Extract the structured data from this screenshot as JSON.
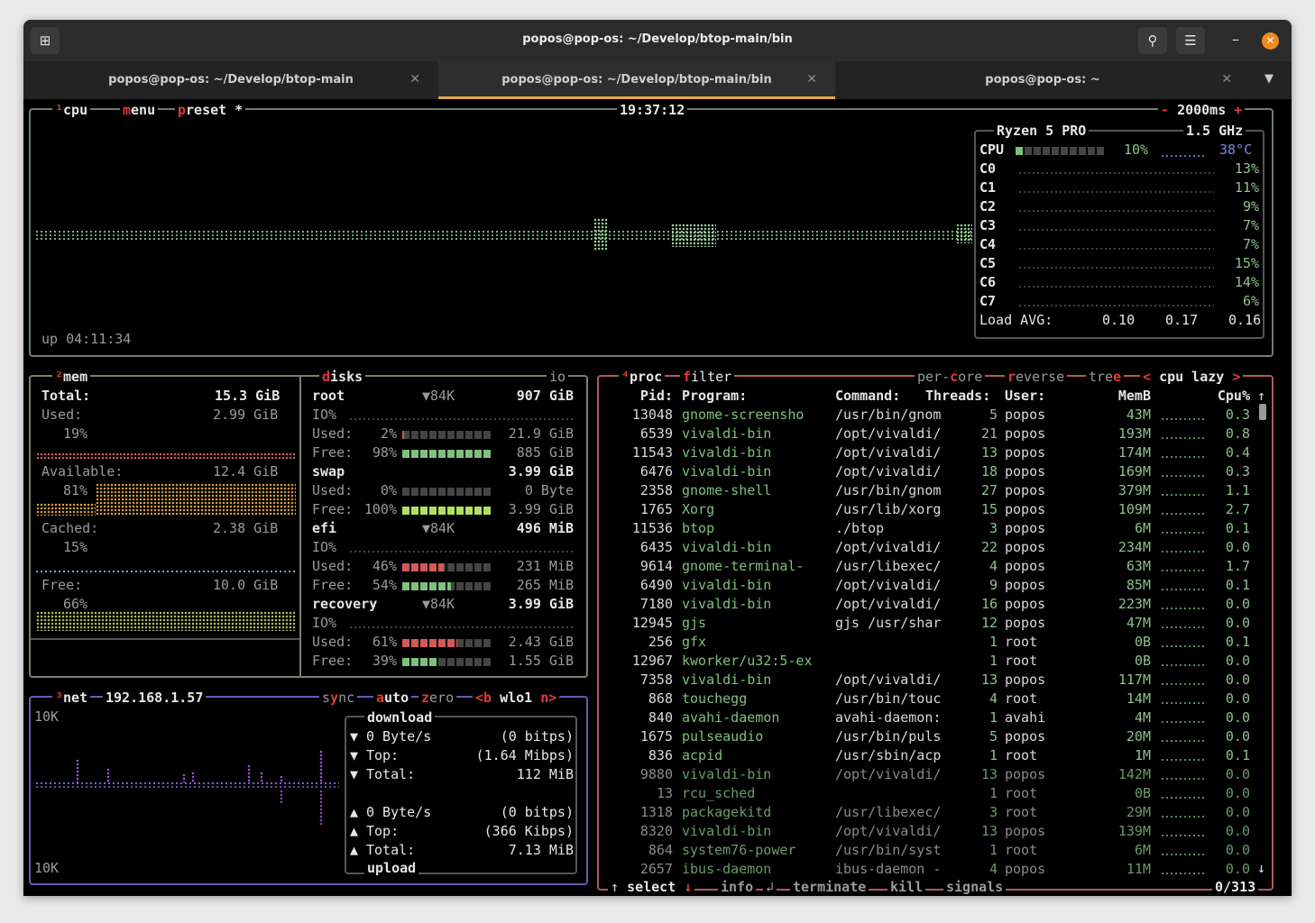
{
  "window": {
    "title": "popos@pop-os: ~/Develop/btop-main/bin"
  },
  "tabs": [
    {
      "label": "popos@pop-os: ~/Develop/btop-main"
    },
    {
      "label": "popos@pop-os: ~/Develop/btop-main/bin"
    },
    {
      "label": "popos@pop-os: ~"
    }
  ],
  "colors": {
    "cpu_border": "#7a8a7a",
    "mem_border": "#8a8a7a",
    "net_border": "#7a6ab0",
    "proc_border": "#b86a6a",
    "accent": "#e03b3b"
  },
  "cpu": {
    "num": "¹",
    "label": "cpu",
    "menu": "menu",
    "preset": "preset *",
    "clock": "19:37:12",
    "interval": "2000ms",
    "minus": "-",
    "plus": "+",
    "uptime": "up 04:11:34",
    "model": "Ryzen 5 PRO",
    "freq": "1.5 GHz",
    "total_label": "CPU",
    "total_pct": "10%",
    "total_fill": 0.1,
    "temp": "38°C",
    "cores": [
      {
        "name": "C0",
        "pct": "13%"
      },
      {
        "name": "C1",
        "pct": "11%"
      },
      {
        "name": "C2",
        "pct": "9%"
      },
      {
        "name": "C3",
        "pct": "7%"
      },
      {
        "name": "C4",
        "pct": "7%"
      },
      {
        "name": "C5",
        "pct": "15%"
      },
      {
        "name": "C6",
        "pct": "14%"
      },
      {
        "name": "C7",
        "pct": "6%"
      }
    ],
    "load_label": "Load AVG:",
    "load": [
      "0.10",
      "0.17",
      "0.16"
    ]
  },
  "mem": {
    "num": "²",
    "label": "mem",
    "total_label": "Total:",
    "total": "15.3 GiB",
    "used_label": "Used:",
    "used": "2.99 GiB",
    "used_pct": "19%",
    "avail_label": "Available:",
    "avail": "12.4 GiB",
    "avail_pct": "81%",
    "cached_label": "Cached:",
    "cached": "2.38 GiB",
    "cached_pct": "15%",
    "free_label": "Free:",
    "free": "10.0 GiB",
    "free_pct": "66%"
  },
  "disks": {
    "label": "disks",
    "io": "io",
    "items": [
      {
        "name": "root",
        "io_speed": "▼84K",
        "size": "907 GiB",
        "io": "IO%",
        "used_label": "Used:",
        "used_pct": "2%",
        "used": "21.9 GiB",
        "used_fill": 0.02,
        "free_label": "Free:",
        "free_pct": "98%",
        "free": "885 GiB",
        "free_fill": 0.98
      },
      {
        "name": "swap",
        "io_speed": "",
        "size": "3.99 GiB",
        "io": "",
        "used_label": "Used:",
        "used_pct": "0%",
        "used": "0 Byte",
        "used_fill": 0,
        "free_label": "Free:",
        "free_pct": "100%",
        "free": "3.99 GiB",
        "free_fill": 1.0
      },
      {
        "name": "efi",
        "io_speed": "▼84K",
        "size": "496 MiB",
        "io": "IO%",
        "used_label": "Used:",
        "used_pct": "46%",
        "used": "231 MiB",
        "used_fill": 0.46,
        "free_label": "Free:",
        "free_pct": "54%",
        "free": "265 MiB",
        "free_fill": 0.54
      },
      {
        "name": "recovery",
        "io_speed": "▼84K",
        "size": "3.99 GiB",
        "io": "IO%",
        "used_label": "Used:",
        "used_pct": "61%",
        "used": "2.43 GiB",
        "used_fill": 0.61,
        "free_label": "Free:",
        "free_pct": "39%",
        "free": "1.55 GiB",
        "free_fill": 0.39
      }
    ]
  },
  "net": {
    "num": "³",
    "label": "net",
    "ip": "192.168.1.57",
    "sync": "sync",
    "auto": "auto",
    "zero": "zero",
    "b": "<b",
    "iface": "wlo1",
    "n": "n>",
    "scale_top": "10K",
    "scale_bottom": "10K",
    "download_label": "download",
    "upload_label": "upload",
    "down": [
      {
        "sym": "▼",
        "label": "0 Byte/s",
        "value": "(0 bitps)"
      },
      {
        "sym": "▼",
        "label": "Top:",
        "value": "(1.64 Mibps)"
      },
      {
        "sym": "▼",
        "label": "Total:",
        "value": "112 MiB"
      }
    ],
    "up": [
      {
        "sym": "▲",
        "label": "0 Byte/s",
        "value": "(0 bitps)"
      },
      {
        "sym": "▲",
        "label": "Top:",
        "value": "(366 Kibps)"
      },
      {
        "sym": "▲",
        "label": "Total:",
        "value": "7.13 MiB"
      }
    ]
  },
  "proc": {
    "num": "⁴",
    "label": "proc",
    "filter": "filter",
    "percore": "per-core",
    "reverse": "reverse",
    "tree": "tree",
    "sort_left": "<",
    "sort": "cpu lazy",
    "sort_right": ">",
    "headers": {
      "pid": "Pid:",
      "program": "Program:",
      "command": "Command:",
      "threads": "Threads:",
      "user": "User:",
      "mem": "MemB",
      "cpu": "Cpu%"
    },
    "rows": [
      {
        "pid": "13048",
        "program": "gnome-screensho",
        "command": "/usr/bin/gnom",
        "threads": "5",
        "user": "popos",
        "mem": "43M",
        "cpu": "0.3"
      },
      {
        "pid": "6539",
        "program": "vivaldi-bin",
        "command": "/opt/vivaldi/",
        "threads": "21",
        "user": "popos",
        "mem": "193M",
        "cpu": "0.8"
      },
      {
        "pid": "11543",
        "program": "vivaldi-bin",
        "command": "/opt/vivaldi/",
        "threads": "13",
        "user": "popos",
        "mem": "174M",
        "cpu": "0.4"
      },
      {
        "pid": "6476",
        "program": "vivaldi-bin",
        "command": "/opt/vivaldi/",
        "threads": "18",
        "user": "popos",
        "mem": "169M",
        "cpu": "0.3"
      },
      {
        "pid": "2358",
        "program": "gnome-shell",
        "command": "/usr/bin/gnom",
        "threads": "27",
        "user": "popos",
        "mem": "379M",
        "cpu": "1.1"
      },
      {
        "pid": "1765",
        "program": "Xorg",
        "command": "/usr/lib/xorg",
        "threads": "15",
        "user": "popos",
        "mem": "109M",
        "cpu": "2.7"
      },
      {
        "pid": "11536",
        "program": "btop",
        "command": "./btop",
        "threads": "3",
        "user": "popos",
        "mem": "6M",
        "cpu": "0.1"
      },
      {
        "pid": "6435",
        "program": "vivaldi-bin",
        "command": "/opt/vivaldi/",
        "threads": "22",
        "user": "popos",
        "mem": "234M",
        "cpu": "0.0"
      },
      {
        "pid": "9614",
        "program": "gnome-terminal-",
        "command": "/usr/libexec/",
        "threads": "4",
        "user": "popos",
        "mem": "63M",
        "cpu": "1.7"
      },
      {
        "pid": "6490",
        "program": "vivaldi-bin",
        "command": "/opt/vivaldi/",
        "threads": "9",
        "user": "popos",
        "mem": "85M",
        "cpu": "0.1"
      },
      {
        "pid": "7180",
        "program": "vivaldi-bin",
        "command": "/opt/vivaldi/",
        "threads": "16",
        "user": "popos",
        "mem": "223M",
        "cpu": "0.0"
      },
      {
        "pid": "12945",
        "program": "gjs",
        "command": "gjs /usr/shar",
        "threads": "12",
        "user": "popos",
        "mem": "47M",
        "cpu": "0.0"
      },
      {
        "pid": "256",
        "program": "gfx",
        "command": "",
        "threads": "1",
        "user": "root",
        "mem": "0B",
        "cpu": "0.1"
      },
      {
        "pid": "12967",
        "program": "kworker/u32:5-ex",
        "command": "",
        "threads": "1",
        "user": "root",
        "mem": "0B",
        "cpu": "0.0"
      },
      {
        "pid": "7358",
        "program": "vivaldi-bin",
        "command": "/opt/vivaldi/",
        "threads": "13",
        "user": "popos",
        "mem": "117M",
        "cpu": "0.0"
      },
      {
        "pid": "868",
        "program": "touchegg",
        "command": "/usr/bin/touc",
        "threads": "4",
        "user": "root",
        "mem": "14M",
        "cpu": "0.0"
      },
      {
        "pid": "840",
        "program": "avahi-daemon",
        "command": "avahi-daemon:",
        "threads": "1",
        "user": "avahi",
        "mem": "4M",
        "cpu": "0.0"
      },
      {
        "pid": "1675",
        "program": "pulseaudio",
        "command": "/usr/bin/puls",
        "threads": "5",
        "user": "popos",
        "mem": "20M",
        "cpu": "0.0"
      },
      {
        "pid": "836",
        "program": "acpid",
        "command": "/usr/sbin/acp",
        "threads": "1",
        "user": "root",
        "mem": "1M",
        "cpu": "0.1"
      },
      {
        "pid": "9880",
        "program": "vivaldi-bin",
        "command": "/opt/vivaldi/",
        "threads": "13",
        "user": "popos",
        "mem": "142M",
        "cpu": "0.0"
      },
      {
        "pid": "13",
        "program": "rcu_sched",
        "command": "",
        "threads": "1",
        "user": "root",
        "mem": "0B",
        "cpu": "0.0"
      },
      {
        "pid": "1318",
        "program": "packagekitd",
        "command": "/usr/libexec/",
        "threads": "3",
        "user": "root",
        "mem": "29M",
        "cpu": "0.0"
      },
      {
        "pid": "8320",
        "program": "vivaldi-bin",
        "command": "/opt/vivaldi/",
        "threads": "13",
        "user": "popos",
        "mem": "139M",
        "cpu": "0.0"
      },
      {
        "pid": "864",
        "program": "system76-power",
        "command": "/usr/bin/syst",
        "threads": "1",
        "user": "root",
        "mem": "6M",
        "cpu": "0.0"
      },
      {
        "pid": "2657",
        "program": "ibus-daemon",
        "command": "ibus-daemon -",
        "threads": "4",
        "user": "popos",
        "mem": "11M",
        "cpu": "0.0"
      }
    ],
    "footer": {
      "up_arrow": "↑",
      "select": "select",
      "down_arrow": "↓",
      "info_sym": "↲",
      "info": "info",
      "terminate": "terminate",
      "kill": "kill",
      "signals": "signals",
      "count": "0/313",
      "scroll_up": "↑",
      "scroll_down": "↓"
    }
  }
}
